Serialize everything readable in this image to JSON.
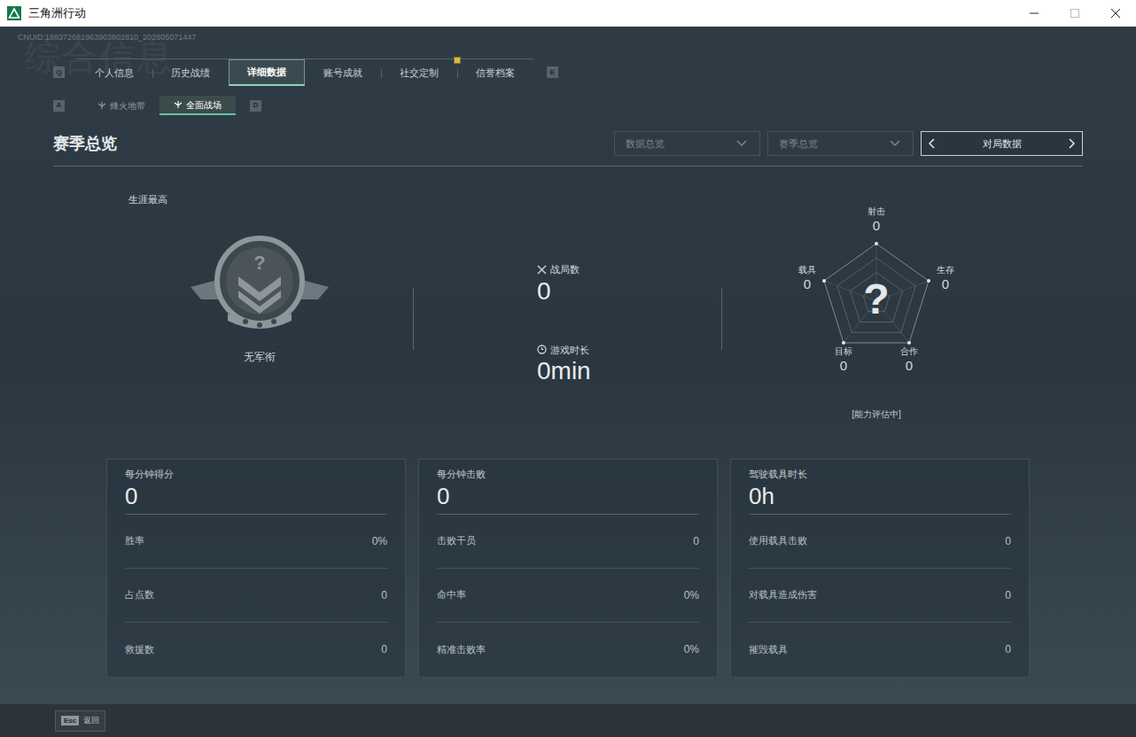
{
  "window": {
    "title": "三角洲行动"
  },
  "uid": "CNUID:188372681963903802810_202605071447",
  "watermark": "综合信息",
  "tabs": {
    "prev_key": "Q",
    "next_key": "E",
    "items": [
      {
        "label": "个人信息",
        "selected": false,
        "badge": false
      },
      {
        "label": "历史战绩",
        "selected": false,
        "badge": false
      },
      {
        "label": "详细数据",
        "selected": true,
        "badge": false
      },
      {
        "label": "账号成就",
        "selected": false,
        "badge": false
      },
      {
        "label": "社交定制",
        "selected": false,
        "badge": true
      },
      {
        "label": "信誉档案",
        "selected": false,
        "badge": false
      }
    ]
  },
  "subtabs": {
    "prev_key": "A",
    "next_key": "D",
    "items": [
      {
        "label": "烽火地带",
        "selected": false
      },
      {
        "label": "全面战场",
        "selected": true
      }
    ]
  },
  "section": {
    "title": "赛季总览",
    "filters": [
      {
        "label": "数据总览"
      },
      {
        "label": "赛季总览"
      }
    ],
    "switcher": {
      "label": "对局数据"
    }
  },
  "rank": {
    "caption": "生涯最高",
    "mark": "?",
    "name": "无军衔"
  },
  "summary": [
    {
      "label": "战局数",
      "value": "0"
    },
    {
      "label": "游戏时长",
      "value": "0min"
    }
  ],
  "radar": {
    "center": "?",
    "status": "[能力评估中]",
    "axes": [
      {
        "label": "射击",
        "value": "0"
      },
      {
        "label": "生存",
        "value": "0"
      },
      {
        "label": "合作",
        "value": "0"
      },
      {
        "label": "目标",
        "value": "0"
      },
      {
        "label": "载具",
        "value": "0"
      }
    ]
  },
  "cards": [
    {
      "title": "每分钟得分",
      "value": "0",
      "rows": [
        {
          "label": "胜率",
          "value": "0%"
        },
        {
          "label": "占点数",
          "value": "0"
        },
        {
          "label": "救援数",
          "value": "0"
        }
      ]
    },
    {
      "title": "每分钟击败",
      "value": "0",
      "rows": [
        {
          "label": "击败干员",
          "value": "0"
        },
        {
          "label": "命中率",
          "value": "0%"
        },
        {
          "label": "精准击败率",
          "value": "0%"
        }
      ]
    },
    {
      "title": "驾驶载具时长",
      "value": "0h",
      "rows": [
        {
          "label": "使用载具击败",
          "value": "0"
        },
        {
          "label": "对载具造成伤害",
          "value": "0"
        },
        {
          "label": "摧毁载具",
          "value": "0"
        }
      ]
    }
  ],
  "footer": {
    "key": "Esc",
    "label": "返回"
  }
}
